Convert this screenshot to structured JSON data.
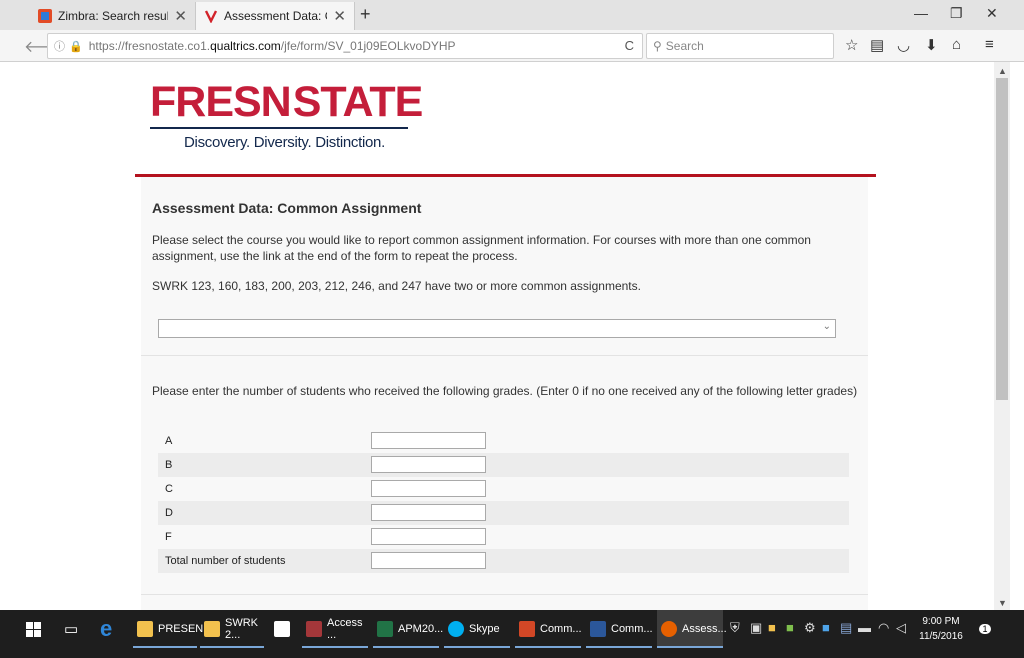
{
  "browser": {
    "tabs": [
      {
        "title": "Zimbra: Search results",
        "active": false
      },
      {
        "title": "Assessment Data: Commo...",
        "active": true
      }
    ],
    "new_tab": "+",
    "url": {
      "prefix": "https://fresnostate.co1.",
      "domain": "qualtrics.com",
      "path": "/jfe/form/SV_01j09EOLkvoDYHP"
    },
    "search_placeholder": "Search"
  },
  "logo": {
    "word_left": "FRESN",
    "word_right": "STATE",
    "tagline": "Discovery. Diversity. Distinction."
  },
  "survey": {
    "title": "Assessment Data: Common Assignment",
    "intro": "Please select the course you would like to report common assignment information. For courses with more than one common assignment, use the link at the end of the form to repeat the process.",
    "note": "SWRK 123, 160, 183, 200, 203, 212, 246, and 247 have two or more common assignments.",
    "course_select": {
      "selected": ""
    },
    "grades_prompt": "Please enter the number of students who received the following grades. (Enter 0 if no one received any of the following letter grades)",
    "grades": [
      {
        "label": "A",
        "value": ""
      },
      {
        "label": "B",
        "value": ""
      },
      {
        "label": "C",
        "value": ""
      },
      {
        "label": "D",
        "value": ""
      },
      {
        "label": "F",
        "value": ""
      },
      {
        "label": "Total number of students",
        "value": ""
      }
    ]
  },
  "taskbar": {
    "items": [
      "PRESEN...",
      "SWRK 2...",
      "Access ...",
      "APM20...",
      "Skype",
      "Comm...",
      "Comm...",
      "Assess..."
    ],
    "time": "9:00 PM",
    "date": "11/5/2016",
    "notifications": "1"
  },
  "colors": {
    "brand_red": "#c41e3a",
    "brand_navy": "#13284c",
    "accent_rule": "#b4121e"
  }
}
